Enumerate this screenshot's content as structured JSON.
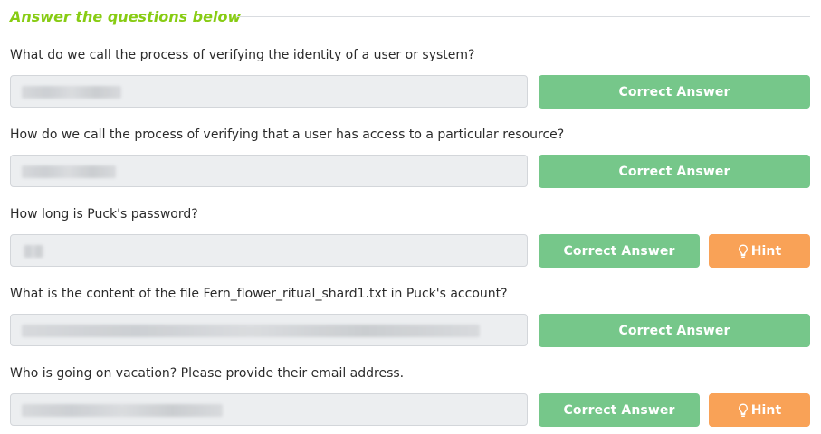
{
  "header": {
    "title": "Answer the questions below"
  },
  "questions": [
    {
      "text": "What do we call the process of verifying the identity of a user or system?",
      "answer_button": "Correct Answer"
    },
    {
      "text": "How do we call the process of verifying that a user has access to a particular resource?",
      "answer_button": "Correct Answer"
    },
    {
      "text": "How long is Puck's password?",
      "answer_button": "Correct Answer",
      "hint_button": "Hint"
    },
    {
      "text": "What is the content of the file Fern_flower_ritual_shard1.txt in Puck's account?",
      "answer_button": "Correct Answer"
    },
    {
      "text": "Who is going on vacation? Please provide their email address.",
      "answer_button": "Correct Answer",
      "hint_button": "Hint"
    }
  ],
  "colors": {
    "accent": "#88cc14",
    "correct": "#76c78a",
    "hint": "#f9a257",
    "field": "#eceef0"
  },
  "icons": {
    "hint": "lightbulb-icon"
  }
}
